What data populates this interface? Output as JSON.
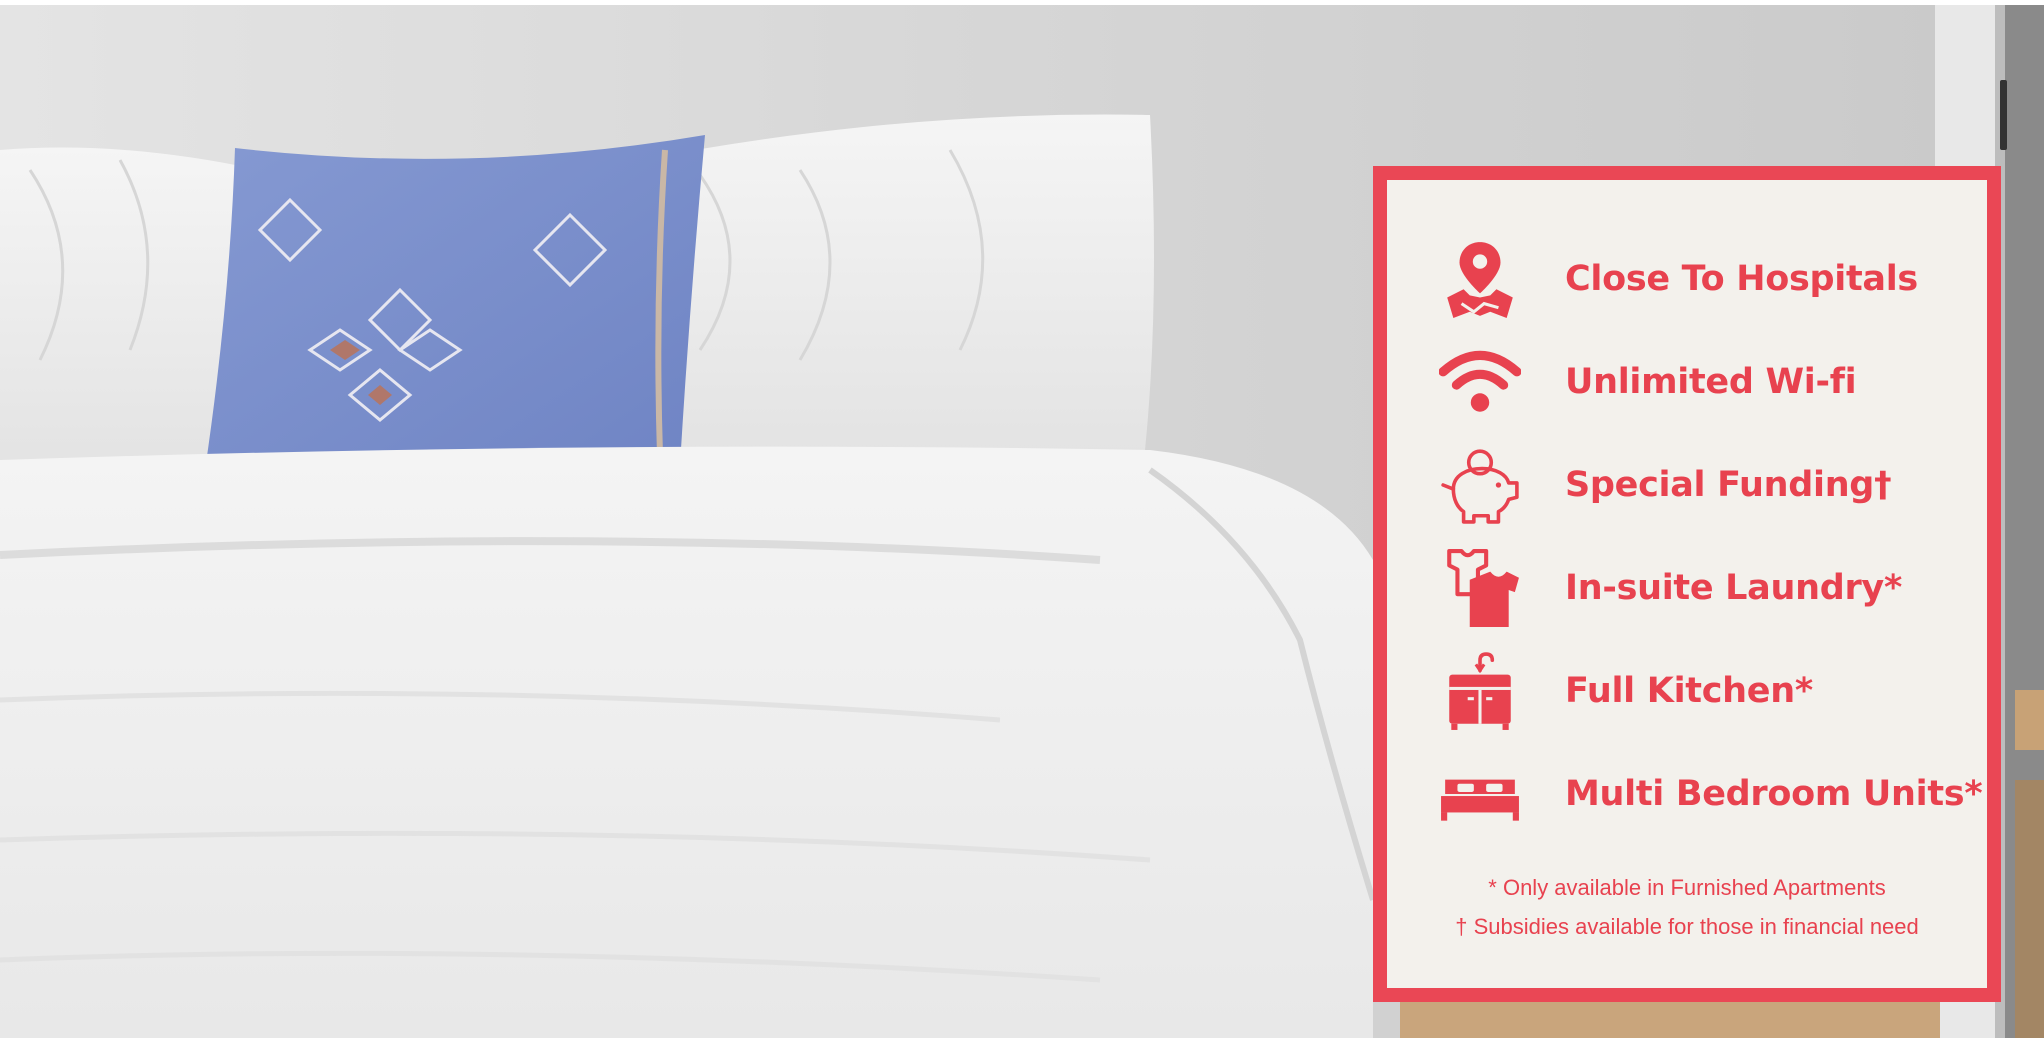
{
  "background": {
    "description_icon": "bed-photo",
    "wall_color": "#dcdcdc",
    "duvet_color": "#f2f2f2",
    "pillow_color": "#7d90cc"
  },
  "card": {
    "border_color": "#ea4755",
    "panel_color": "#f3f1ec",
    "text_color": "#e8424f",
    "features": [
      {
        "icon": "map-pin-icon",
        "label": "Close To Hospitals"
      },
      {
        "icon": "wifi-icon",
        "label": "Unlimited Wi-fi"
      },
      {
        "icon": "piggy-bank-icon",
        "label": "Special Funding†"
      },
      {
        "icon": "laundry-shirt-icon",
        "label": "In-suite Laundry*"
      },
      {
        "icon": "kitchen-sink-icon",
        "label": "Full Kitchen*"
      },
      {
        "icon": "bed-icon",
        "label": "Multi Bedroom Units*"
      }
    ],
    "notes": [
      "* Only available in Furnished Apartments",
      "† Subsidies available for those in financial need"
    ]
  }
}
